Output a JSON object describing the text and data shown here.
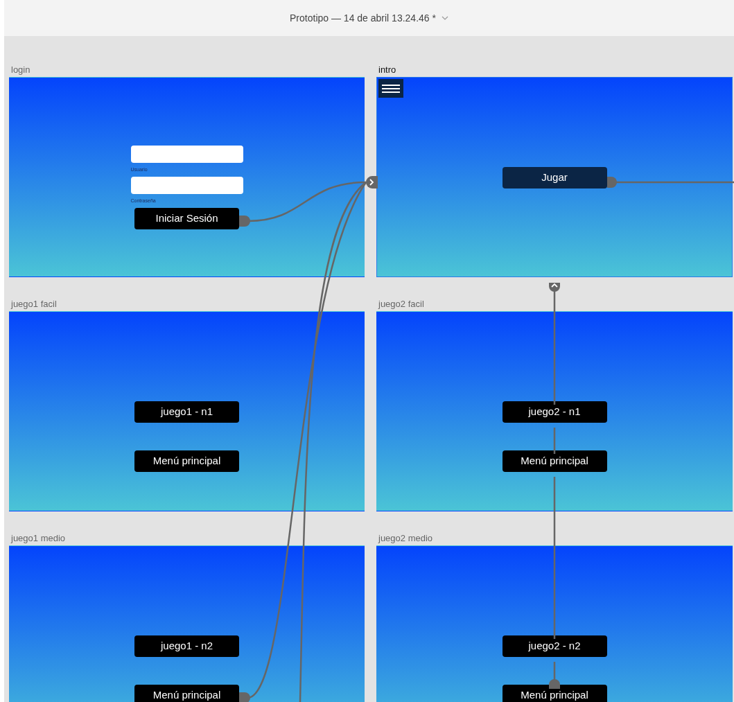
{
  "window": {
    "title": "Prototipo — 14 de abril 13.24.46 *"
  },
  "artboards": [
    {
      "label": "login",
      "selected": false,
      "kind": "login",
      "elements": [
        {
          "kind": "field",
          "caption": "Usuario"
        },
        {
          "kind": "field",
          "caption": "Contraseña"
        },
        {
          "kind": "button",
          "label": "Iniciar Sesión",
          "color": "#000000"
        }
      ]
    },
    {
      "label": "intro",
      "selected": true,
      "kind": "menu",
      "elements": [
        {
          "kind": "button",
          "label": "Jugar",
          "color": "#0b2545"
        }
      ]
    },
    {
      "label": "juego1 facil",
      "selected": false,
      "kind": "game",
      "elements": [
        {
          "kind": "button",
          "label": "juego1 - n1",
          "color": "#000000"
        },
        {
          "kind": "button",
          "label": "Menú principal",
          "color": "#000000"
        }
      ]
    },
    {
      "label": "juego2 facil",
      "selected": false,
      "kind": "game",
      "elements": [
        {
          "kind": "button",
          "label": "juego2 - n1",
          "color": "#000000"
        },
        {
          "kind": "button",
          "label": "Menú principal",
          "color": "#000000"
        }
      ]
    },
    {
      "label": "juego1 medio",
      "selected": false,
      "kind": "game",
      "elements": [
        {
          "kind": "button",
          "label": "juego1 - n2",
          "color": "#000000"
        },
        {
          "kind": "button",
          "label": "Menú principal",
          "color": "#000000"
        }
      ]
    },
    {
      "label": "juego2 medio",
      "selected": false,
      "kind": "game",
      "elements": [
        {
          "kind": "button",
          "label": "juego2 - n2",
          "color": "#000000"
        },
        {
          "kind": "button",
          "label": "Menú principal",
          "color": "#000000"
        }
      ]
    }
  ]
}
